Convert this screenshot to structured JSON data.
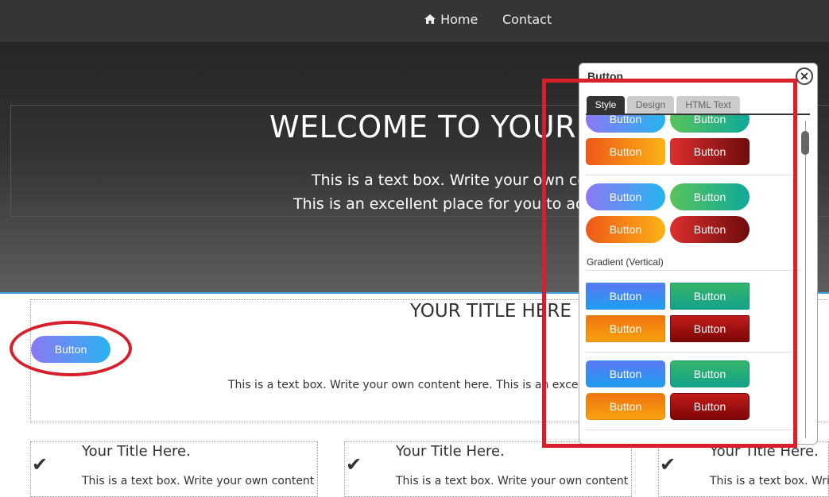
{
  "nav": {
    "home": "Home",
    "contact": "Contact"
  },
  "hero": {
    "title": "WELCOME TO YOUR",
    "line1": "This is a text box. Write your own co",
    "line2": "This is an excellent place for you to add"
  },
  "section": {
    "title": "YOUR TITLE HERE",
    "button": "Button",
    "text": "This is a text box. Write your own content here. This is an excellent p"
  },
  "features": [
    {
      "title": "Your Title Here.",
      "text": "This is a text box. Write your own content"
    },
    {
      "title": "Your Title Here.",
      "text": "This is a text box. Write your own content"
    },
    {
      "title": "Your Title Here.",
      "text": "This is a text box. Write"
    }
  ],
  "panel": {
    "title": "Button",
    "tabs": [
      "Style",
      "Design",
      "HTML Text"
    ],
    "active_tab": "Style",
    "section_label": "Gradient (Vertical)",
    "button_label": "Button"
  },
  "colors": {
    "accent": "#3aa0de",
    "annotation": "#d7202b"
  }
}
